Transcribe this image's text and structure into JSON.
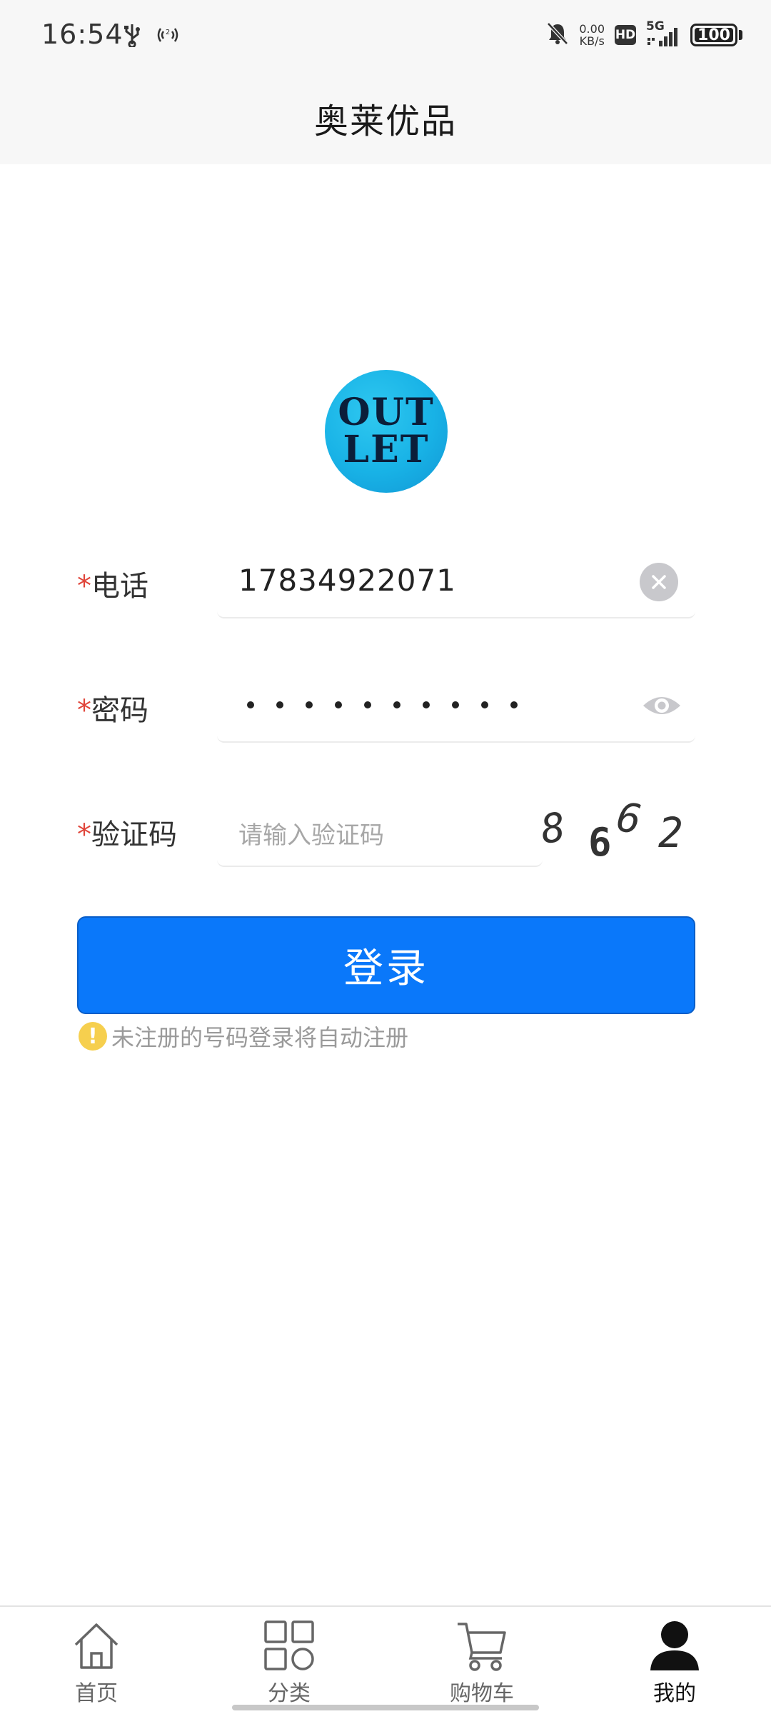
{
  "status_bar": {
    "time": "16:54",
    "net_speed_value": "0.00",
    "net_speed_unit": "KB/s",
    "hd_label": "HD",
    "network_label": "5G",
    "battery": "100",
    "icons": [
      "usb-icon",
      "hotspot-icon",
      "mute-bell-icon",
      "signal-icon",
      "battery-icon"
    ]
  },
  "header": {
    "title": "奥莱优品"
  },
  "logo": {
    "line1": "OUT",
    "line2": "LET",
    "color": "#18b2e6"
  },
  "form": {
    "required_mark": "*",
    "phone": {
      "label": "电话",
      "value": "17834922071"
    },
    "password": {
      "label": "密码",
      "masked_length": 10
    },
    "captcha": {
      "label": "验证码",
      "placeholder": "请输入验证码",
      "code": [
        "8",
        "6",
        "6",
        "2"
      ]
    }
  },
  "login_button": {
    "label": "登录",
    "color": "#0a78fa"
  },
  "hint": {
    "icon": "!",
    "text": "未注册的号码登录将自动注册"
  },
  "tabs": [
    {
      "label": "首页",
      "icon": "home-icon",
      "active": false
    },
    {
      "label": "分类",
      "icon": "category-grid-icon",
      "active": false
    },
    {
      "label": "购物车",
      "icon": "cart-icon",
      "active": false
    },
    {
      "label": "我的",
      "icon": "user-icon",
      "active": true
    }
  ]
}
